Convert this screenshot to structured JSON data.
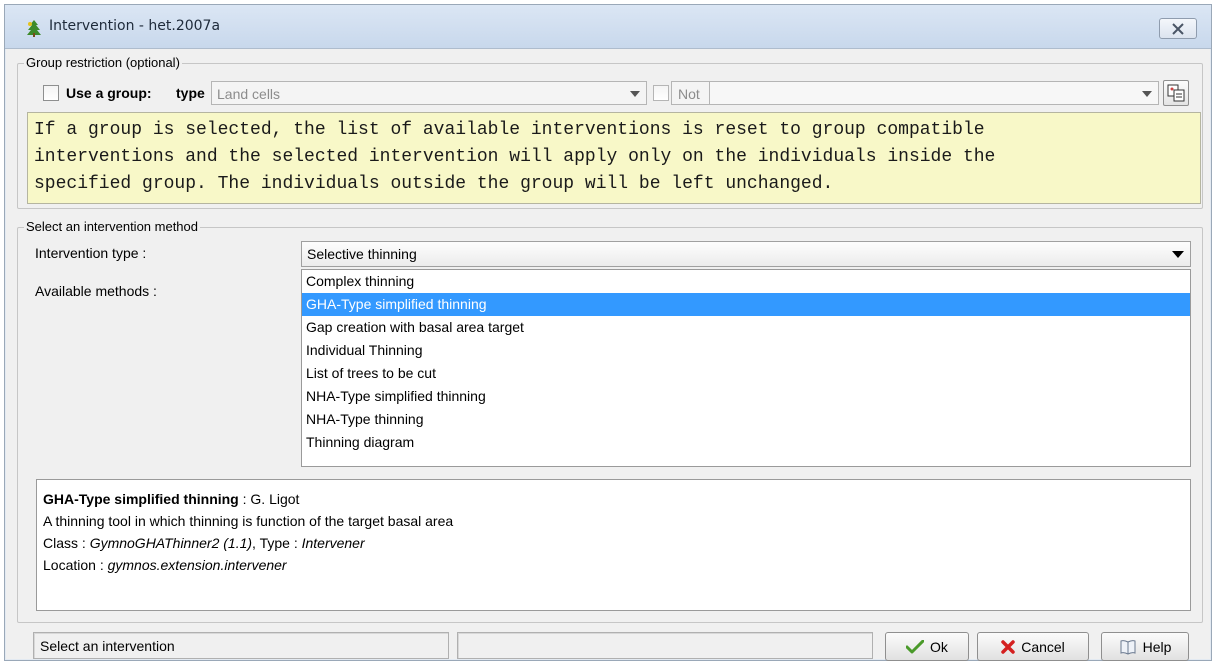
{
  "window": {
    "title": "Intervention - het.2007a",
    "icons": {
      "app": "app-tree-icon",
      "close": "close-icon"
    }
  },
  "group_restriction": {
    "legend": "Group restriction (optional)",
    "use_group_label": "Use a group:",
    "type_label": "type",
    "type_value": "Land cells",
    "not_label": "Not",
    "group_value": "",
    "note": "If a group is selected, the list of available interventions is reset to group compatible\ninterventions and the selected intervention will apply only on the individuals inside the\nspecified group. The individuals outside the group will be left unchanged."
  },
  "method": {
    "legend": "Select an intervention method",
    "type_label": "Intervention type :",
    "type_value": "Selective thinning",
    "methods_label": "Available methods :",
    "methods": [
      "Complex thinning",
      "GHA-Type simplified thinning",
      "Gap creation with basal area target",
      "Individual Thinning",
      "List of trees to be cut",
      "NHA-Type simplified thinning",
      "NHA-Type thinning",
      "Thinning diagram"
    ],
    "selected_index": 1
  },
  "description": {
    "name": "GHA-Type simplified thinning",
    "author_sep": " : ",
    "author": "G. Ligot",
    "summary": "A thinning tool in which thinning is function of the target basal area",
    "class_label": "Class : ",
    "class_value": "GymnoGHAThinner2 (1.1)",
    "type_sep": ", Type : ",
    "type_value": "Intervener",
    "location_label": "Location : ",
    "location_value": "gymnos.extension.intervener"
  },
  "footer": {
    "status_text": "Select an intervention",
    "status_text_2": "",
    "ok_label": "Ok",
    "cancel_label": "Cancel",
    "help_label": "Help"
  },
  "colors": {
    "selection": "#3399ff",
    "note_background": "#f8f8c8",
    "ok_check": "#4a9a2a",
    "cancel_x": "#d42020"
  }
}
